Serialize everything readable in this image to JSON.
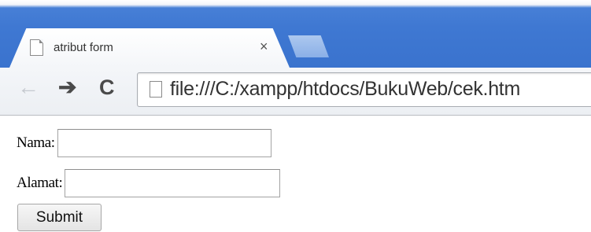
{
  "browser": {
    "tab": {
      "title": "atribut form",
      "close_glyph": "×",
      "favicon": "page-icon"
    },
    "new_tab": "new-tab-icon",
    "toolbar": {
      "back_glyph": "←",
      "forward_glyph": "➔",
      "reload_glyph": "C",
      "address": "file:///C:/xampp/htdocs/BukuWeb/cek.htm",
      "address_icon": "page-icon"
    },
    "colors": {
      "tabstrip": "#3f78d2",
      "toolbar": "#eceff3"
    }
  },
  "form": {
    "fields": [
      {
        "label": "Nama:",
        "value": ""
      },
      {
        "label": "Alamat:",
        "value": ""
      }
    ],
    "submit_label": "Submit"
  }
}
